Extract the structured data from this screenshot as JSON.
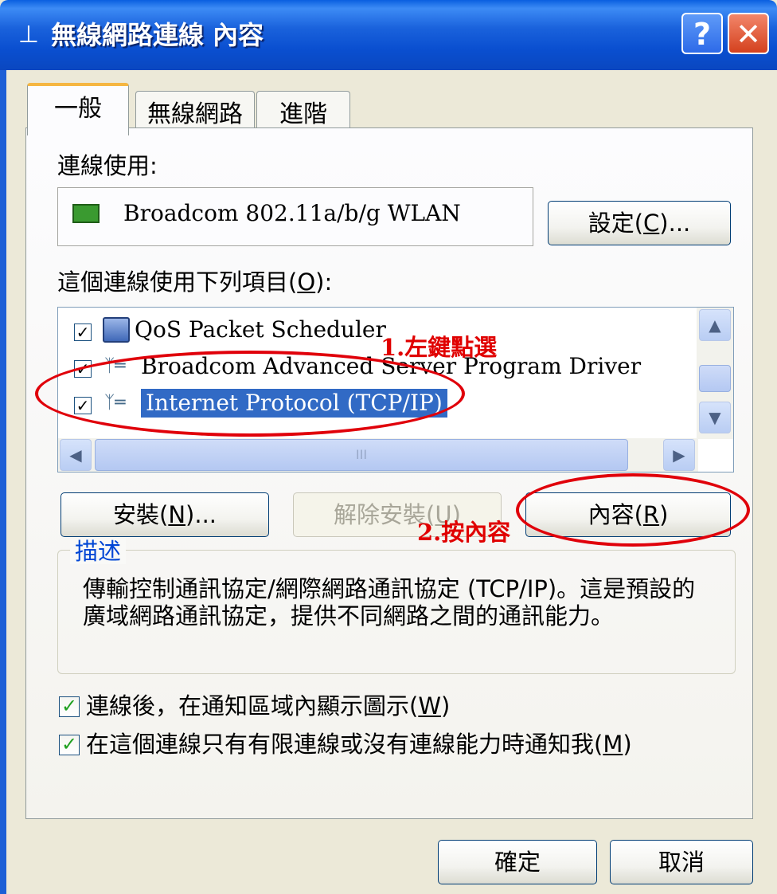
{
  "window": {
    "title": "無線網路連線 內容",
    "help_glyph": "?",
    "close_glyph": "✕"
  },
  "tabs": [
    "一般",
    "無線網路",
    "進階"
  ],
  "connect_using": {
    "label": "連線使用:",
    "adapter": "Broadcom 802.11a/b/g WLAN",
    "configure_button": {
      "text": "設定(",
      "mnemonic": "C",
      "suffix": ")..."
    }
  },
  "items_section": {
    "label": "這個連線使用下列項目(",
    "mnemonic": "O",
    "suffix": "):",
    "items": [
      {
        "label": "QoS Packet Scheduler",
        "checked": true,
        "selected": false,
        "icon": "computer-icon"
      },
      {
        "label": "Broadcom Advanced Server Program Driver",
        "checked": true,
        "selected": false,
        "icon": "network-protocol-icon"
      },
      {
        "label": "Internet Protocol (TCP/IP)",
        "checked": true,
        "selected": true,
        "icon": "network-protocol-icon"
      }
    ],
    "hscroll_grip": "III"
  },
  "action_buttons": {
    "install": {
      "text": "安裝(",
      "mnemonic": "N",
      "suffix": ")..."
    },
    "uninstall": {
      "text": "解除安裝(",
      "mnemonic": "U",
      "suffix": ")"
    },
    "properties": {
      "text": "內容(",
      "mnemonic": "R",
      "suffix": ")"
    }
  },
  "description": {
    "title": "描述",
    "text": "傳輸控制通訊協定/網際網路通訊協定 (TCP/IP)。這是預設的廣域網路通訊協定，提供不同網路之間的通訊能力。"
  },
  "options": [
    {
      "text": "連線後，在通知區域內顯示圖示(",
      "mnemonic": "W",
      "suffix": ")",
      "checked": true
    },
    {
      "text": "在這個連線只有有限連線或沒有連線能力時通知我(",
      "mnemonic": "M",
      "suffix": ")",
      "checked": true
    }
  ],
  "footer": {
    "ok": "確定",
    "cancel": "取消"
  },
  "annotations": {
    "step1_num": "1.",
    "step1_text": "左鍵點選",
    "step2_num": "2.",
    "step2_text": "按內容",
    "color": "#e00000"
  },
  "colors": {
    "titlebar": "#0a4fd0",
    "dialog_bg": "#ece9d8",
    "selection": "#316ac5",
    "group_title": "#0046d5",
    "tab_highlight": "#f5b642"
  }
}
